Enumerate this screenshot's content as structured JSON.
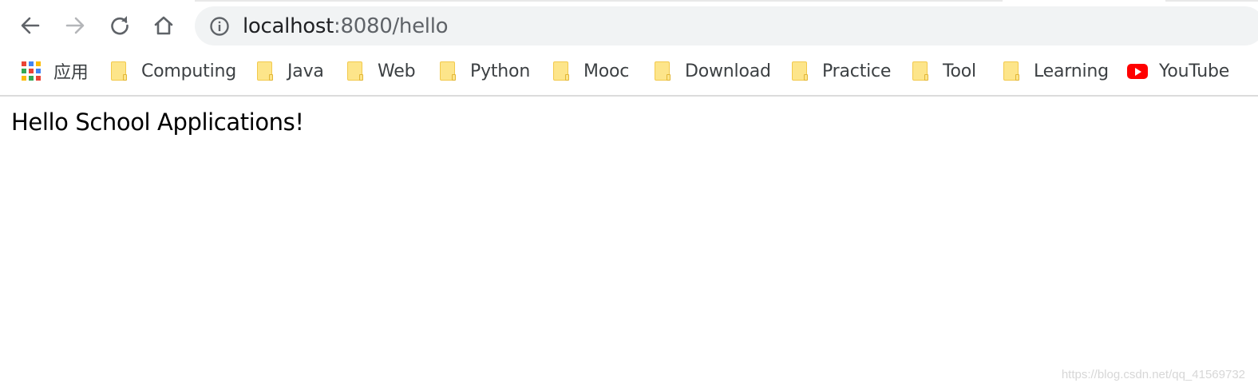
{
  "address_bar": {
    "host": "localhost",
    "path": ":8080/hello"
  },
  "toolbar": {
    "back_icon": "arrow-left-icon",
    "forward_icon": "arrow-right-icon",
    "reload_icon": "reload-icon",
    "home_icon": "home-icon",
    "info_icon": "info-icon"
  },
  "bookmarks": {
    "apps_label": "应用",
    "items": [
      {
        "label": "Computing",
        "icon": "folder-icon"
      },
      {
        "label": "Java",
        "icon": "folder-icon"
      },
      {
        "label": "Web",
        "icon": "folder-icon"
      },
      {
        "label": "Python",
        "icon": "folder-icon"
      },
      {
        "label": "Mooc",
        "icon": "folder-icon"
      },
      {
        "label": "Download",
        "icon": "folder-icon"
      },
      {
        "label": "Practice",
        "icon": "folder-icon"
      },
      {
        "label": "Tool",
        "icon": "folder-icon"
      },
      {
        "label": "Learning",
        "icon": "folder-icon"
      }
    ],
    "youtube_label": "YouTube"
  },
  "page": {
    "content_text": "Hello School Applications!"
  },
  "watermark": "https://blog.csdn.net/qq_41569732",
  "colors": {
    "omnibox_bg": "#f1f3f4",
    "folder_fill": "#fde58a",
    "youtube_red": "#ff0000",
    "apps_grid": [
      "#ea4335",
      "#4285f4",
      "#fbbc05",
      "#34a853",
      "#ea4335",
      "#4285f4",
      "#fbbc05",
      "#34a853",
      "#ea4335"
    ]
  }
}
